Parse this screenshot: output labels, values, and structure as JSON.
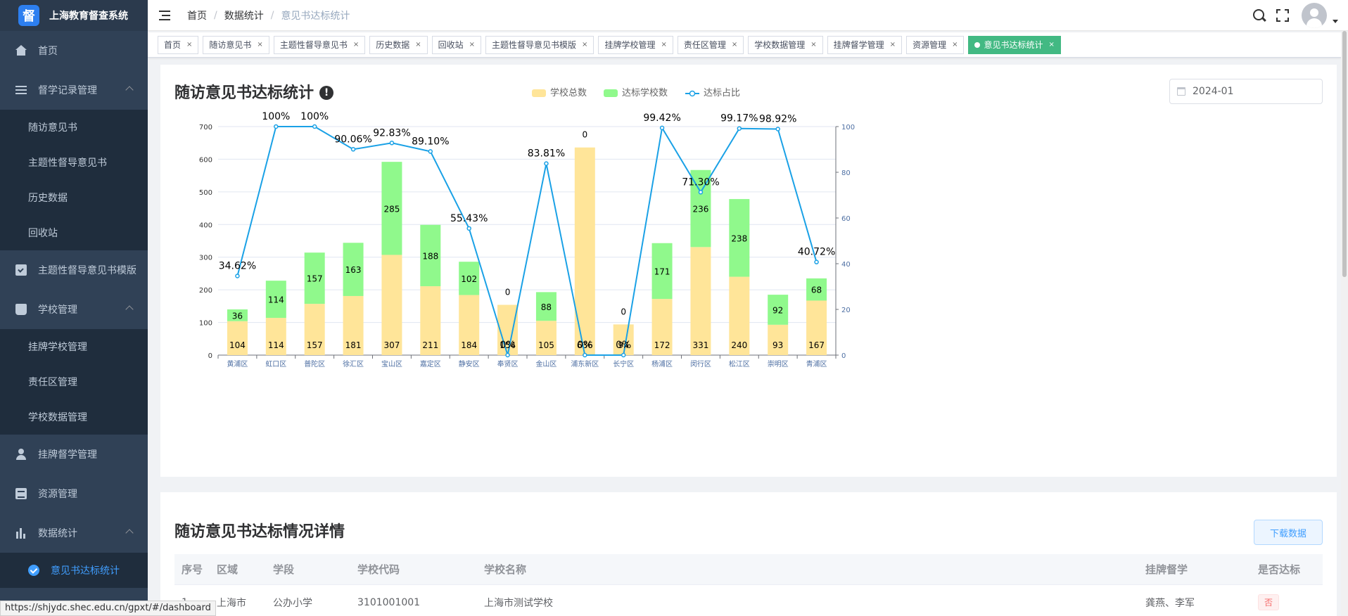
{
  "app": {
    "title": "上海教育督查系统",
    "logo_char": "督"
  },
  "sidebar": {
    "items": [
      {
        "label": "首页",
        "icon": "home-icon"
      },
      {
        "label": "督学记录管理",
        "icon": "list-icon",
        "expanded": true,
        "children": [
          "随访意见书",
          "主题性督导意见书",
          "历史数据",
          "回收站"
        ]
      },
      {
        "label": "主题性督导意见书模版",
        "icon": "clipboard-icon"
      },
      {
        "label": "学校管理",
        "icon": "book-icon",
        "expanded": true,
        "children": [
          "挂牌学校管理",
          "责任区管理",
          "学校数据管理"
        ]
      },
      {
        "label": "挂牌督学管理",
        "icon": "user-icon"
      },
      {
        "label": "资源管理",
        "icon": "document-icon"
      },
      {
        "label": "数据统计",
        "icon": "bar-chart-icon",
        "expanded": true,
        "children": [
          "意见书达标统计"
        ]
      }
    ],
    "active": "意见书达标统计"
  },
  "breadcrumb": [
    "首页",
    "数据统计",
    "意见书达标统计"
  ],
  "tags": [
    "首页",
    "随访意见书",
    "主题性督导意见书",
    "历史数据",
    "回收站",
    "主题性督导意见书模版",
    "挂牌学校管理",
    "责任区管理",
    "学校数据管理",
    "挂牌督学管理",
    "资源管理",
    "意见书达标统计"
  ],
  "active_tag": "意见书达标统计",
  "card1": {
    "title": "随访意见书达标统计",
    "date": "2024-01"
  },
  "chart_data": {
    "type": "bar",
    "stacked": true,
    "categories": [
      "黄浦区",
      "虹口区",
      "普陀区",
      "徐汇区",
      "宝山区",
      "嘉定区",
      "静安区",
      "奉贤区",
      "金山区",
      "浦东新区",
      "长宁区",
      "杨浦区",
      "闵行区",
      "松江区",
      "崇明区",
      "青浦区"
    ],
    "series": [
      {
        "name": "学校总数",
        "type": "bar",
        "color": "#ffe599",
        "values": [
          104,
          114,
          157,
          181,
          307,
          211,
          184,
          154,
          105,
          636,
          94,
          172,
          331,
          240,
          93,
          167
        ]
      },
      {
        "name": "达标学校数",
        "type": "bar",
        "color": "#90f98c",
        "values": [
          36,
          114,
          157,
          163,
          285,
          188,
          102,
          0,
          88,
          0,
          0,
          171,
          236,
          238,
          92,
          68
        ]
      },
      {
        "name": "达标占比",
        "type": "line",
        "color": "#1aa1e6",
        "axis": "right",
        "values": [
          34.62,
          100,
          100,
          90.06,
          92.83,
          89.1,
          55.43,
          0,
          83.81,
          0,
          0,
          99.42,
          71.3,
          99.17,
          98.92,
          40.72
        ]
      }
    ],
    "bar_labels_bottom": [
      "104",
      "114",
      "157",
      "181",
      "307",
      "211",
      "184",
      "154",
      "105",
      "636",
      "94",
      "172",
      "331",
      "240",
      "93",
      "167"
    ],
    "bar_labels_top": [
      "36",
      "114",
      "157",
      "163",
      "285",
      "188",
      "102",
      "0",
      "88",
      "0",
      "0",
      "171",
      "236",
      "238",
      "92",
      "68"
    ],
    "line_labels": [
      "34.62%",
      "100%",
      "100%",
      "90.06%",
      "92.83%",
      "89.10%",
      "55.43%",
      "0%",
      "83.81%",
      "0%",
      "0%",
      "99.42%",
      "71.30%",
      "99.17%",
      "98.92%",
      "40.72%"
    ],
    "y_left": {
      "ticks": [
        "0",
        "100",
        "200",
        "300",
        "400",
        "500",
        "600",
        "700"
      ],
      "max": 700
    },
    "y_right": {
      "ticks": [
        "0",
        "20",
        "40",
        "60",
        "80",
        "100"
      ],
      "max": 100
    },
    "legend_position": "top-center",
    "grid": true
  },
  "card2": {
    "title": "随访意见书达标情况详情",
    "download_label": "下载数据",
    "columns": [
      "序号",
      "区域",
      "学段",
      "学校代码",
      "学校名称",
      "挂牌督学",
      "是否达标"
    ],
    "rows": [
      [
        "1",
        "上海市",
        "公办小学",
        "3101001001",
        "上海市测试学校",
        "龚燕、李军",
        "否"
      ]
    ]
  },
  "status_url": "https://shjydc.shec.edu.cn/gpxt/#/dashboard"
}
